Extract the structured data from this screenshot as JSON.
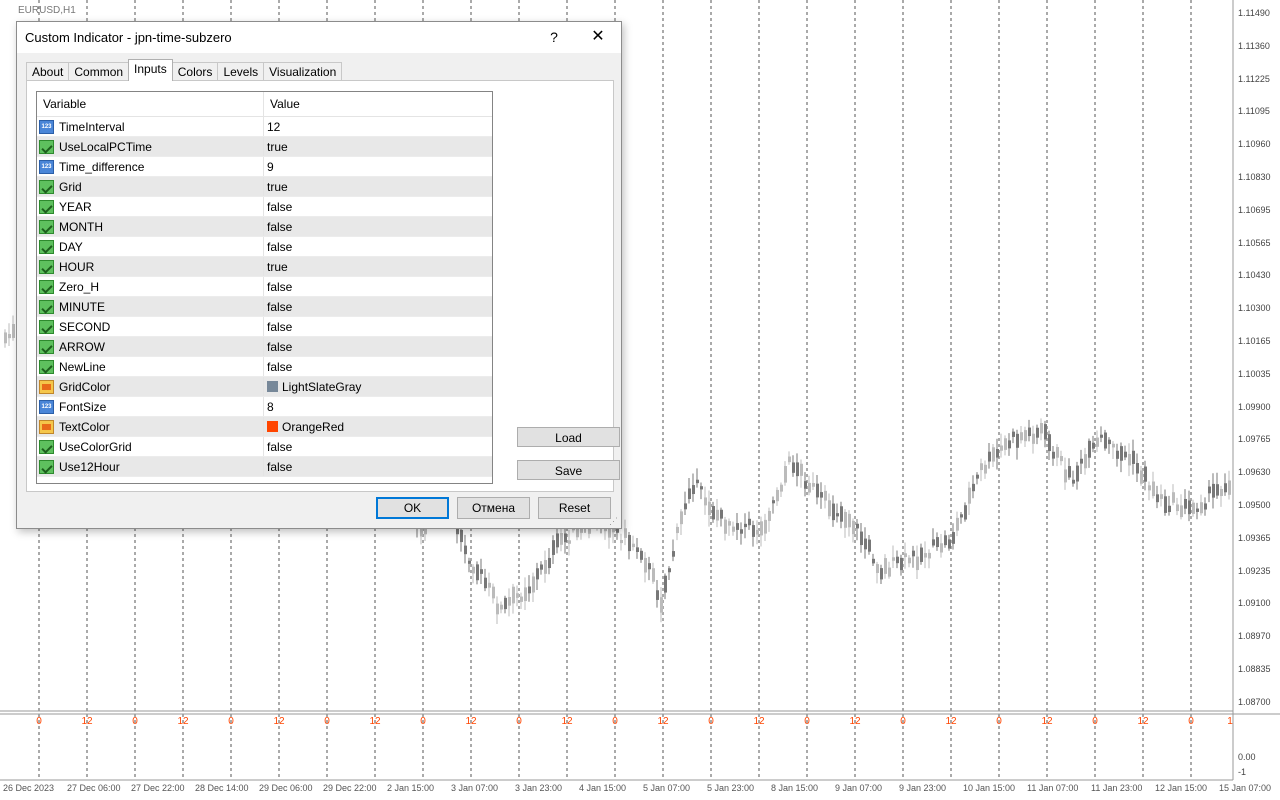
{
  "chart": {
    "symbol": "EURUSD,H1",
    "price_labels": [
      "1.11490",
      "1.11360",
      "1.11225",
      "1.11095",
      "1.10960",
      "1.10830",
      "1.10695",
      "1.10565",
      "1.10430",
      "1.10300",
      "1.10165",
      "1.10035",
      "1.09900",
      "1.09765",
      "1.09630",
      "1.09500",
      "1.09365",
      "1.09235",
      "1.09100",
      "1.08970",
      "1.08835",
      "1.08700"
    ],
    "sub_labels": [
      "0.00",
      "-1"
    ],
    "time_labels": [
      "26 Dec 2023",
      "27 Dec 06:00",
      "27 Dec 22:00",
      "28 Dec 14:00",
      "29 Dec 06:00",
      "29 Dec 22:00",
      "2 Jan 15:00",
      "3 Jan 07:00",
      "3 Jan 23:00",
      "4 Jan 15:00",
      "5 Jan 07:00",
      "5 Jan 23:00",
      "8 Jan 15:00",
      "9 Jan 07:00",
      "9 Jan 23:00",
      "10 Jan 15:00",
      "11 Jan 07:00",
      "11 Jan 23:00",
      "12 Jan 15:00",
      "15 Jan 07:00"
    ],
    "grid_hour_labels": [
      "0",
      "12",
      "0",
      "12",
      "0",
      "12",
      "0",
      "12",
      "0",
      "12",
      "0",
      "12",
      "0",
      "12",
      "0",
      "12",
      "0",
      "12",
      "0",
      "12",
      "0",
      "12",
      "0",
      "12",
      "0",
      "1"
    ],
    "grid_color": "#778899",
    "text_color": "#ff4500"
  },
  "dialog": {
    "title": "Custom Indicator - jpn-time-subzero",
    "help": "?",
    "close": "✕",
    "tabs": [
      "About",
      "Common",
      "Inputs",
      "Colors",
      "Levels",
      "Visualization"
    ],
    "active_tab": "Inputs",
    "columns": {
      "variable": "Variable",
      "value": "Value"
    },
    "rows": [
      {
        "name": "TimeInterval",
        "value": "12",
        "type": "int"
      },
      {
        "name": "UseLocalPCTime",
        "value": "true",
        "type": "bool"
      },
      {
        "name": "Time_difference",
        "value": "9",
        "type": "int"
      },
      {
        "name": "Grid",
        "value": "true",
        "type": "bool"
      },
      {
        "name": "YEAR",
        "value": "false",
        "type": "bool"
      },
      {
        "name": "MONTH",
        "value": "false",
        "type": "bool"
      },
      {
        "name": "DAY",
        "value": "false",
        "type": "bool"
      },
      {
        "name": "HOUR",
        "value": "true",
        "type": "bool"
      },
      {
        "name": "Zero_H",
        "value": "false",
        "type": "bool"
      },
      {
        "name": "MINUTE",
        "value": "false",
        "type": "bool"
      },
      {
        "name": "SECOND",
        "value": "false",
        "type": "bool"
      },
      {
        "name": "ARROW",
        "value": "false",
        "type": "bool"
      },
      {
        "name": "NewLine",
        "value": "false",
        "type": "bool"
      },
      {
        "name": "GridColor",
        "value": "LightSlateGray",
        "type": "color",
        "color": "#778899"
      },
      {
        "name": "FontSize",
        "value": "8",
        "type": "int"
      },
      {
        "name": "TextColor",
        "value": "OrangeRed",
        "type": "color",
        "color": "#ff4500"
      },
      {
        "name": "UseColorGrid",
        "value": "false",
        "type": "bool"
      },
      {
        "name": "Use12Hour",
        "value": "false",
        "type": "bool"
      }
    ],
    "load_label": "Load",
    "save_label": "Save",
    "ok_label": "OK",
    "cancel_label": "Отмена",
    "reset_label": "Reset"
  }
}
